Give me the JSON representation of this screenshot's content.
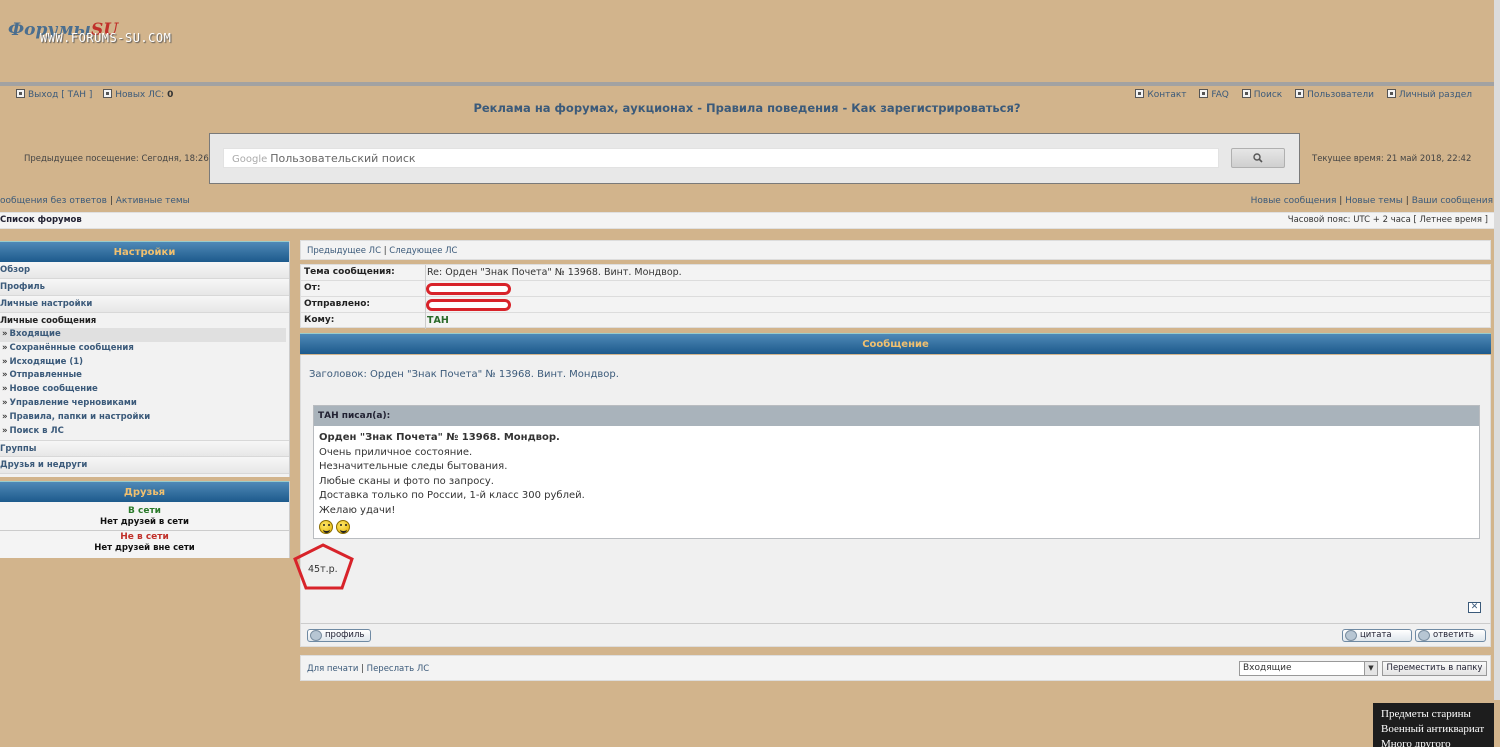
{
  "header": {
    "logo_text": "Форумы",
    "logo_suffix": "SU",
    "logo_url": "WWW.FORUMS-SU.COM",
    "promo": "Реклама на форумах, аукционах - Правила поведения - Как зарегистрироваться?",
    "logout": "Выход [ ТАН ]",
    "new_pm_label": "Новых ЛС:",
    "new_pm_count": "0",
    "nav_right": [
      "Контакт",
      "FAQ",
      "Поиск",
      "Пользователи",
      "Личный раздел"
    ],
    "prev_visit": "Предыдущее посещение: Сегодня, 18:26",
    "current_time": "Текущее время: 21 май 2018, 22:42"
  },
  "search": {
    "google_label": "Google",
    "placeholder": "Пользовательский поиск",
    "button_icon": "search-icon"
  },
  "links": {
    "left_1": "ообщения без ответов",
    "left_2": "Активные темы",
    "right_1": "Новые сообщения",
    "right_2": "Новые темы",
    "right_3": "Ваши сообщения"
  },
  "navbar": {
    "forum_list": "Список форумов",
    "timezone": "Часовой пояс: UTC + 2 часа [ Летнее время ]"
  },
  "sidebar": {
    "settings_title": "Настройки",
    "items": [
      "Обзор",
      "Профиль",
      "Личные настройки"
    ],
    "pm_group_title": "Личные сообщения",
    "pm_items": [
      "Входящие",
      "Сохранённые сообщения",
      "Исходящие (1)",
      "Отправленные",
      "Новое сообщение",
      "Управление черновиками",
      "Правила, папки и настройки",
      "Поиск в ЛС"
    ],
    "bottom_items": [
      "Группы",
      "Друзья и недруги"
    ],
    "friends_title": "Друзья",
    "online_label": "В сети",
    "online_none": "Нет друзей в сети",
    "offline_label": "Не в сети",
    "offline_none": "Нет друзей вне сети"
  },
  "message": {
    "nav_prev": "Предыдущее ЛС",
    "nav_next": "Следующее ЛС",
    "subject_label": "Тема сообщения:",
    "subject_value": "Re: Орден \"Знак Почета\" № 13968. Винт. Мондвор.",
    "from_label": "От:",
    "sent_label": "Отправлено:",
    "to_label": "Кому:",
    "to_value": "ТАН",
    "section_title": "Сообщение",
    "body_subject": "Заголовок: Орден \"Знак Почета\" № 13968. Винт. Мондвор.",
    "quote_header": "ТАН писал(а):",
    "quote_lines": [
      "Орден \"Знак Почета\" № 13968. Мондвор.",
      "Очень приличное состояние.",
      "Незначительные следы бытования.",
      "Любые сканы и фото по запросу.",
      "Доставка только по России, 1-й класс 300 рублей.",
      "Желаю удачи!"
    ],
    "price": "45т.р.",
    "close_glyph": "✕",
    "profile_btn": "профиль",
    "quote_btn": "цитата",
    "reply_btn": "ответить",
    "print_link": "Для печати",
    "forward_link": "Переслать ЛС",
    "folder_select": "Входящие",
    "move_btn": "Переместить в папку"
  },
  "ad": {
    "lines": [
      "Предметы старины",
      "Военный антиквариат",
      "Много другого"
    ]
  },
  "colors": {
    "background": "#d2b48c",
    "link": "#3b5a7a",
    "header_gradient_top": "#4f89b7",
    "header_gradient_bottom": "#1d5a8c",
    "header_text": "#f0c070",
    "redaction": "#d8232a"
  }
}
